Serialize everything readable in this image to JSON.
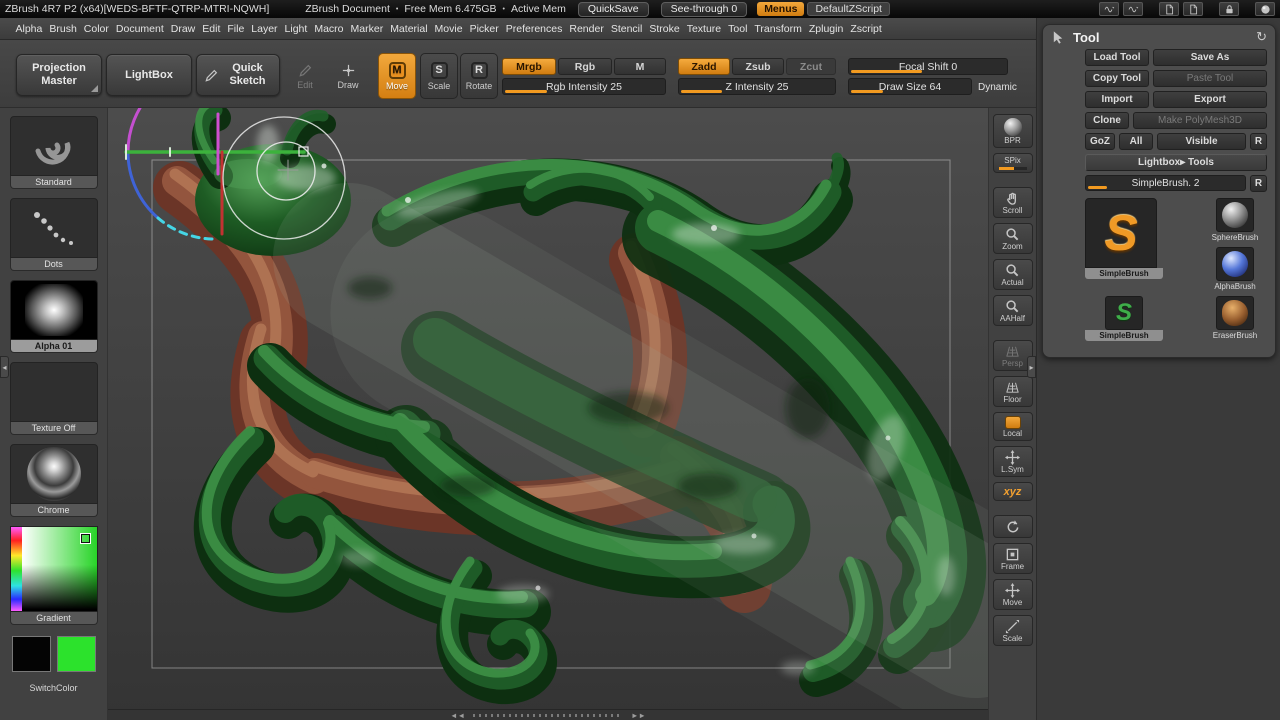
{
  "titlebar": {
    "title": "ZBrush 4R7 P2 (x64)[WEDS-BFTF-QTRP-MTRI-NQWH]",
    "document_name": "ZBrush Document",
    "bullet": "•",
    "free_mem": "Free Mem 6.475GB",
    "active_mem": "Active Mem",
    "quicksave_label": "QuickSave",
    "see_through_label": "See-through 0",
    "menus_label": "Menus",
    "zscript_label": "DefaultZScript"
  },
  "menubar": {
    "items": [
      "Alpha",
      "Brush",
      "Color",
      "Document",
      "Draw",
      "Edit",
      "File",
      "Layer",
      "Light",
      "Macro",
      "Marker",
      "Material",
      "Movie",
      "Picker",
      "Preferences",
      "Render",
      "Stencil",
      "Stroke",
      "Texture",
      "Tool",
      "Transform",
      "Zplugin",
      "Zscript"
    ]
  },
  "shelf": {
    "projection_master": "Projection Master",
    "lightbox": "LightBox",
    "quick_sketch": "Quick Sketch",
    "edit": {
      "label": "Edit"
    },
    "draw": {
      "label": "Draw"
    },
    "move": {
      "label": "Move",
      "letter": "M"
    },
    "scale": {
      "label": "Scale",
      "letter": "S"
    },
    "rotate": {
      "label": "Rotate",
      "letter": "R"
    },
    "mrgb": "Mrgb",
    "rgb": "Rgb",
    "m": "M",
    "zadd": "Zadd",
    "zsub": "Zsub",
    "zcut": "Zcut",
    "rgb_intensity": {
      "label": "Rgb Intensity 25",
      "fill": "26%"
    },
    "z_intensity": {
      "label": "Z Intensity 25",
      "fill": "26%"
    },
    "focal_shift": {
      "label": "Focal Shift 0",
      "fill": "45%"
    },
    "draw_size": {
      "label": "Draw Size 64",
      "fill": "26%"
    },
    "dynamic": "Dynamic"
  },
  "left_sidebar": {
    "brush_label": "Standard",
    "stroke_label": "Dots",
    "alpha_label": "Alpha 01",
    "texture_label": "Texture Off",
    "material_label": "Chrome",
    "gradient_label": "Gradient",
    "switch_label": "SwitchColor"
  },
  "right_toolbar": {
    "items": [
      {
        "label": "BPR"
      },
      {
        "label": "SPix",
        "fill": "55%"
      },
      {
        "label": "Scroll"
      },
      {
        "label": "Zoom"
      },
      {
        "label": "Actual"
      },
      {
        "label": "AAHalf"
      },
      {
        "label": "Persp"
      },
      {
        "label": "Floor"
      },
      {
        "label": "Local"
      },
      {
        "label": "L.Sym"
      },
      {
        "label": "xyz"
      },
      {
        "label": ""
      },
      {
        "label": "Frame"
      },
      {
        "label": "Move"
      },
      {
        "label": "Scale"
      }
    ]
  },
  "tool_panel": {
    "title": "Tool",
    "load_tool": "Load Tool",
    "save_as": "Save As",
    "copy_tool": "Copy Tool",
    "paste_tool": "Paste Tool",
    "import": "Import",
    "export": "Export",
    "clone": "Clone",
    "make_polymesh": "Make PolyMesh3D",
    "goz": "GoZ",
    "all": "All",
    "visible": "Visible",
    "r": "R",
    "lightbox_tools": "Lightbox▸ Tools",
    "active_tool": {
      "label": "SimpleBrush. 2",
      "fill": "12%"
    },
    "r2": "R",
    "s_glyph": "S",
    "brush1": "SimpleBrush",
    "brush2": "SphereBrush",
    "brush3": "AlphaBrush",
    "brush4": "SimpleBrush",
    "brush5": "EraserBrush"
  },
  "canvas": {
    "scroll_left": "◄◄",
    "scroll_right": "►►"
  },
  "icons": {
    "refresh": "↻",
    "collapse_left": "◂",
    "expand_right": "▸"
  },
  "colors": {
    "accent_orange": "#e8912d",
    "picker_green": "#2ee22e"
  }
}
